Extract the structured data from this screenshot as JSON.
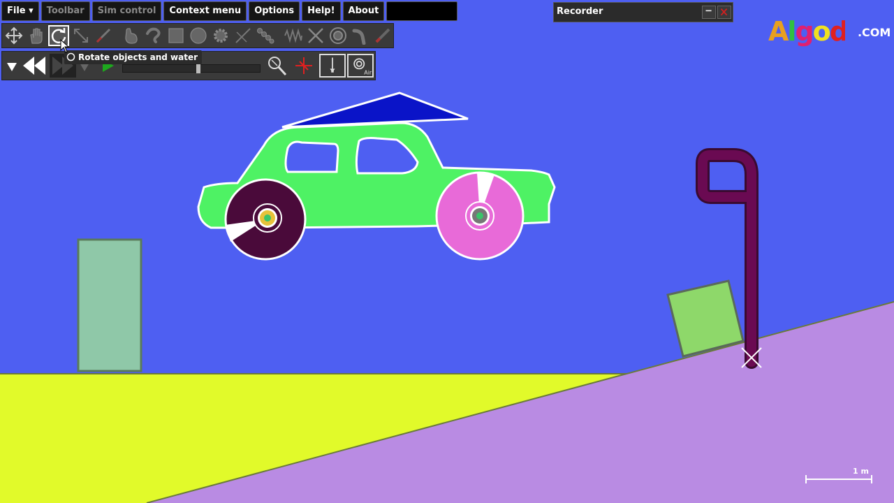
{
  "menu": {
    "file": "File ▾",
    "toolbar": "Toolbar",
    "sim_control": "Sim control",
    "context_menu": "Context menu",
    "options": "Options",
    "help": "Help!",
    "about": "About"
  },
  "tooltip": {
    "text": "Rotate objects and water"
  },
  "recorder": {
    "title": "Recorder"
  },
  "logo": {
    "text": "Algodoo",
    "suffix": ".COM"
  },
  "scale": {
    "label": "1 m"
  },
  "colors": {
    "sky": "#4e5ff2",
    "yellow_ground": "#e1fa2a",
    "purple_slope": "#b98be3",
    "car_body": "#4ef264",
    "wheel_dark": "#4a0a3a",
    "wheel_pink": "#e86ad8",
    "roof_triangle": "#0a14c8",
    "teal_block": "#8fc8a8",
    "green_block": "#8ed86a",
    "hook": "#6a0a52"
  }
}
